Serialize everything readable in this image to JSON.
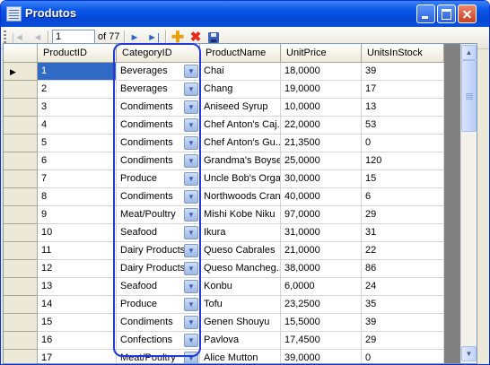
{
  "window": {
    "title": "Produtos"
  },
  "navigator": {
    "position": "1",
    "count": "of 77",
    "first_glyph": "|◄",
    "prev_glyph": "◄",
    "next_glyph": "►",
    "last_glyph": "►|",
    "add_glyph": "✚",
    "delete_glyph": "✖"
  },
  "grid": {
    "columns": [
      "ProductID",
      "CategoryID",
      "ProductName",
      "UnitPrice",
      "UnitsInStock"
    ],
    "current_row_glyph": "▶",
    "combo_arrow": "▼",
    "rows": [
      [
        "1",
        "Beverages",
        "Chai",
        "18,0000",
        "39"
      ],
      [
        "2",
        "Beverages",
        "Chang",
        "19,0000",
        "17"
      ],
      [
        "3",
        "Condiments",
        "Aniseed Syrup",
        "10,0000",
        "13"
      ],
      [
        "4",
        "Condiments",
        "Chef Anton's Caj...",
        "22,0000",
        "53"
      ],
      [
        "5",
        "Condiments",
        "Chef Anton's Gu...",
        "21,3500",
        "0"
      ],
      [
        "6",
        "Condiments",
        "Grandma's Boyse...",
        "25,0000",
        "120"
      ],
      [
        "7",
        "Produce",
        "Uncle Bob's Orga...",
        "30,0000",
        "15"
      ],
      [
        "8",
        "Condiments",
        "Northwoods Cran...",
        "40,0000",
        "6"
      ],
      [
        "9",
        "Meat/Poultry",
        "Mishi Kobe Niku",
        "97,0000",
        "29"
      ],
      [
        "10",
        "Seafood",
        "Ikura",
        "31,0000",
        "31"
      ],
      [
        "11",
        "Dairy Products",
        "Queso Cabrales",
        "21,0000",
        "22"
      ],
      [
        "12",
        "Dairy Products",
        "Queso Mancheg...",
        "38,0000",
        "86"
      ],
      [
        "13",
        "Seafood",
        "Konbu",
        "6,0000",
        "24"
      ],
      [
        "14",
        "Produce",
        "Tofu",
        "23,2500",
        "35"
      ],
      [
        "15",
        "Condiments",
        "Genen Shouyu",
        "15,5000",
        "39"
      ],
      [
        "16",
        "Confections",
        "Pavlova",
        "17,4500",
        "29"
      ],
      [
        "17",
        "Meat/Poultry",
        "Alice Mutton",
        "39,0000",
        "0"
      ]
    ]
  },
  "scrollbar": {
    "up_glyph": "▲",
    "down_glyph": "▼"
  },
  "colors": {
    "selection": "#316ac5",
    "annotation": "#2438d8",
    "titlebar": "#0547d6"
  }
}
